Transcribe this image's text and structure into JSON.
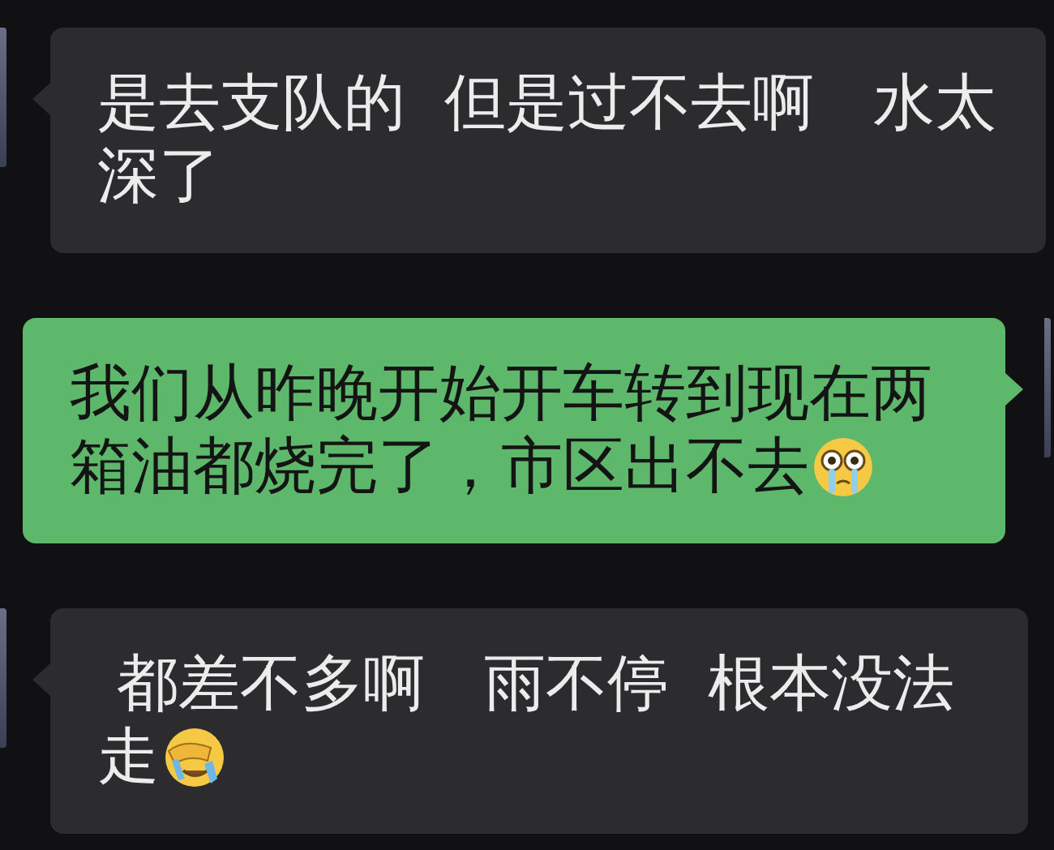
{
  "messages": [
    {
      "kind": "incoming",
      "lines": [
        "是去支队的  但是过不去啊   水太",
        "深了"
      ]
    },
    {
      "kind": "outgoing",
      "lines": [
        "我们从昨晚开始开车转到现在两",
        "箱油都烧完了，市区出不去"
      ],
      "emoji": {
        "kind": "tearful"
      }
    },
    {
      "kind": "incoming",
      "lines": [
        " 都差不多啊   雨不停  根本没法",
        "走"
      ],
      "emoji": {
        "kind": "facepalm"
      }
    }
  ]
}
